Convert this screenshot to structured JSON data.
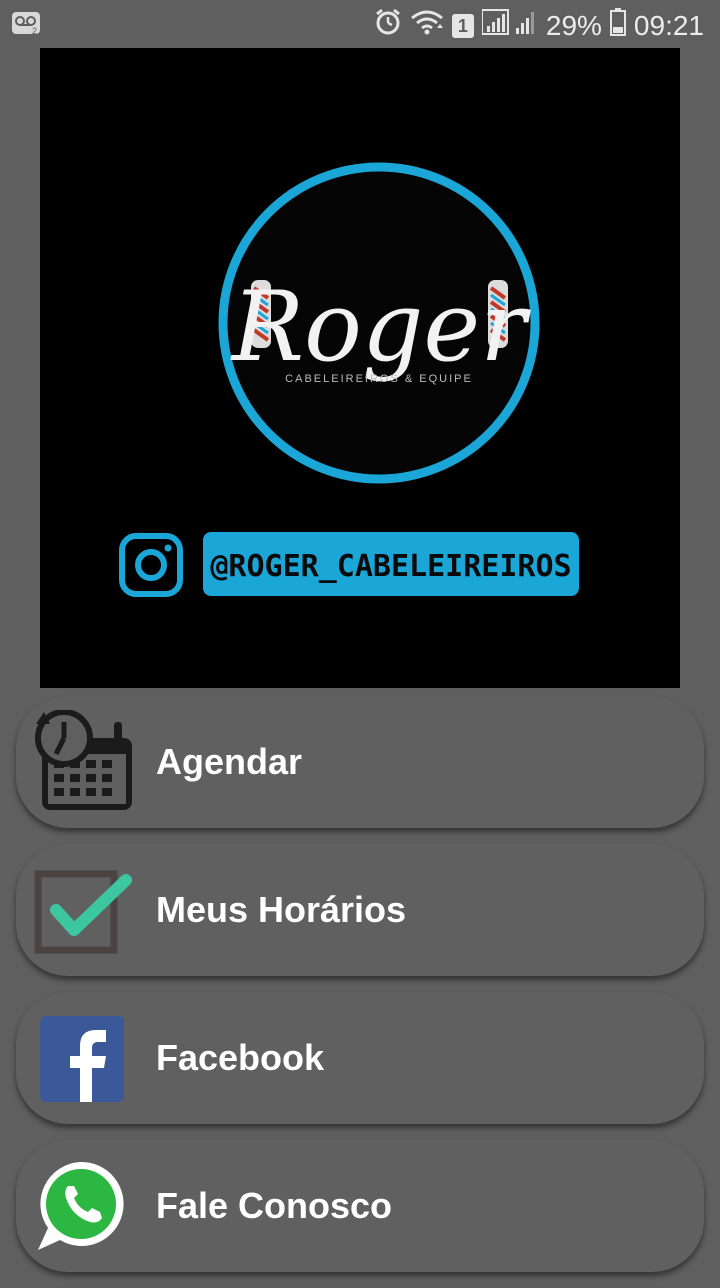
{
  "status_bar": {
    "battery_percent": "29%",
    "time": "09:21",
    "sim_slot": "1",
    "icons": [
      "voicemail-icon",
      "alarm-icon",
      "wifi-icon",
      "signal-icon",
      "battery-icon"
    ]
  },
  "banner": {
    "brand_name": "Roger",
    "brand_tagline": "CABELEIREIROS & EQUIPE",
    "instagram_handle": "@ROGER_CABELEIREIROS",
    "colors": {
      "accent": "#1aa6d6",
      "background": "#000000"
    }
  },
  "menu": {
    "items": [
      {
        "label": "Agendar",
        "icon": "calendar-clock-icon"
      },
      {
        "label": "Meus Horários",
        "icon": "checkbox-check-icon"
      },
      {
        "label": "Facebook",
        "icon": "facebook-icon"
      },
      {
        "label": "Fale Conosco",
        "icon": "whatsapp-icon"
      }
    ]
  },
  "colors": {
    "page_background": "#5f5f5f",
    "menu_item_background": "#606060",
    "label_text": "#ffffff",
    "check_green": "#3cc7a0",
    "facebook_blue": "#3b5998",
    "whatsapp_green": "#2bb741"
  }
}
